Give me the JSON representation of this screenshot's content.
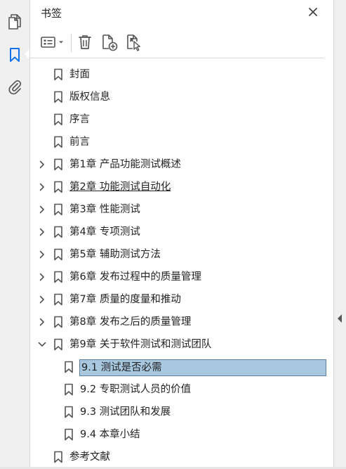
{
  "panel": {
    "title": "书签"
  },
  "rail": {
    "items": [
      {
        "name": "pages",
        "icon": "pages-icon"
      },
      {
        "name": "bookmarks",
        "icon": "bookmark-icon",
        "active": true
      },
      {
        "name": "attachments",
        "icon": "paperclip-icon"
      }
    ]
  },
  "toolbar": {
    "tools": [
      "options-menu-icon",
      "trash-icon",
      "new-bookmark-icon",
      "find-bookmark-icon"
    ]
  },
  "bookmarks": [
    {
      "label": "封面",
      "level": 0,
      "expandable": false
    },
    {
      "label": "版权信息",
      "level": 0,
      "expandable": false
    },
    {
      "label": "序言",
      "level": 0,
      "expandable": false
    },
    {
      "label": "前言",
      "level": 0,
      "expandable": false
    },
    {
      "label": "第1章 产品功能测试概述",
      "level": 0,
      "expandable": true,
      "expanded": false
    },
    {
      "label": "第2章 功能测试自动化",
      "level": 0,
      "expandable": true,
      "expanded": false,
      "underlined": true
    },
    {
      "label": "第3章 性能测试",
      "level": 0,
      "expandable": true,
      "expanded": false
    },
    {
      "label": "第4章 专项测试",
      "level": 0,
      "expandable": true,
      "expanded": false
    },
    {
      "label": "第5章 辅助测试方法",
      "level": 0,
      "expandable": true,
      "expanded": false
    },
    {
      "label": "第6章 发布过程中的质量管理",
      "level": 0,
      "expandable": true,
      "expanded": false
    },
    {
      "label": "第7章 质量的度量和推动",
      "level": 0,
      "expandable": true,
      "expanded": false
    },
    {
      "label": "第8章 发布之后的质量管理",
      "level": 0,
      "expandable": true,
      "expanded": false
    },
    {
      "label": "第9章 关于软件测试和测试团队",
      "level": 0,
      "expandable": true,
      "expanded": true
    },
    {
      "label": "9.1 测试是否必需",
      "level": 1,
      "expandable": false,
      "selected": true
    },
    {
      "label": "9.2 专职测试人员的价值",
      "level": 1,
      "expandable": false
    },
    {
      "label": "9.3 测试团队和发展",
      "level": 1,
      "expandable": false
    },
    {
      "label": "9.4 本章小结",
      "level": 1,
      "expandable": false
    },
    {
      "label": "参考文献",
      "level": 0,
      "expandable": false
    }
  ],
  "colors": {
    "selection": "#a8c8e0",
    "selection_border": "#5a7fa0",
    "icon": "#555555",
    "active_icon": "#1473e6"
  }
}
